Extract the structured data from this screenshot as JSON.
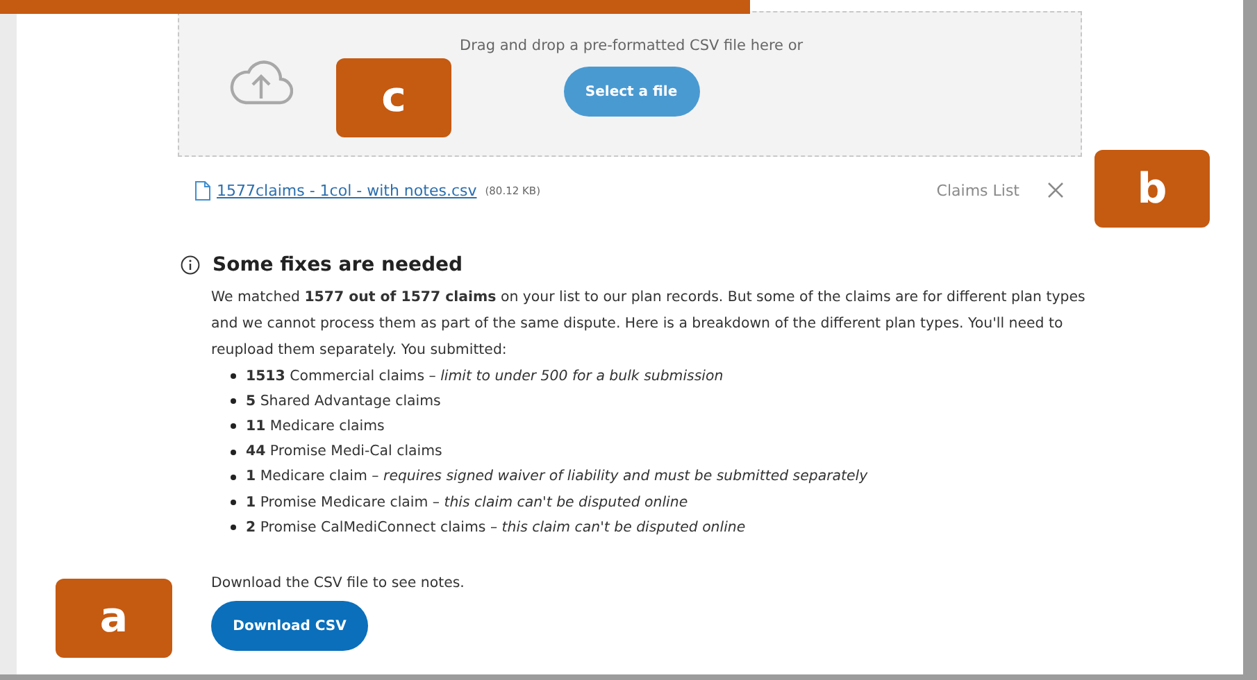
{
  "upload": {
    "prompt": "Drag and drop a pre-formatted CSV file here or",
    "button": "Select a file"
  },
  "file": {
    "name": "1577claims - 1col - with notes.csv",
    "size": "(80.12 KB)",
    "list_label": "Claims List"
  },
  "notice": {
    "title": "Some fixes are needed",
    "body": "We matched **1577 out of 1577 claims** on your list to our plan records. But some of the claims are for different plan types and we cannot process them as part of the same dispute. Here is a breakdown of the different plan types. You'll need to reupload them separately. You submitted:",
    "items": [
      "**1513** Commercial claims – *limit to under 500 for a bulk submission*",
      "**5** Shared Advantage claims",
      "**11** Medicare claims",
      "**44** Promise Medi-Cal claims",
      "**1** Medicare claim – *requires signed waiver of liability and must be submitted separately*",
      "**1** Promise Medicare claim – *this claim can't be disputed online*",
      "**2** Promise CalMediConnect claims – *this claim can't be disputed online*"
    ]
  },
  "download": {
    "hint": "Download the CSV file to see notes.",
    "button": "Download CSV"
  },
  "annotations": [
    {
      "label": "c"
    },
    {
      "label": "b"
    },
    {
      "label": "a"
    }
  ]
}
